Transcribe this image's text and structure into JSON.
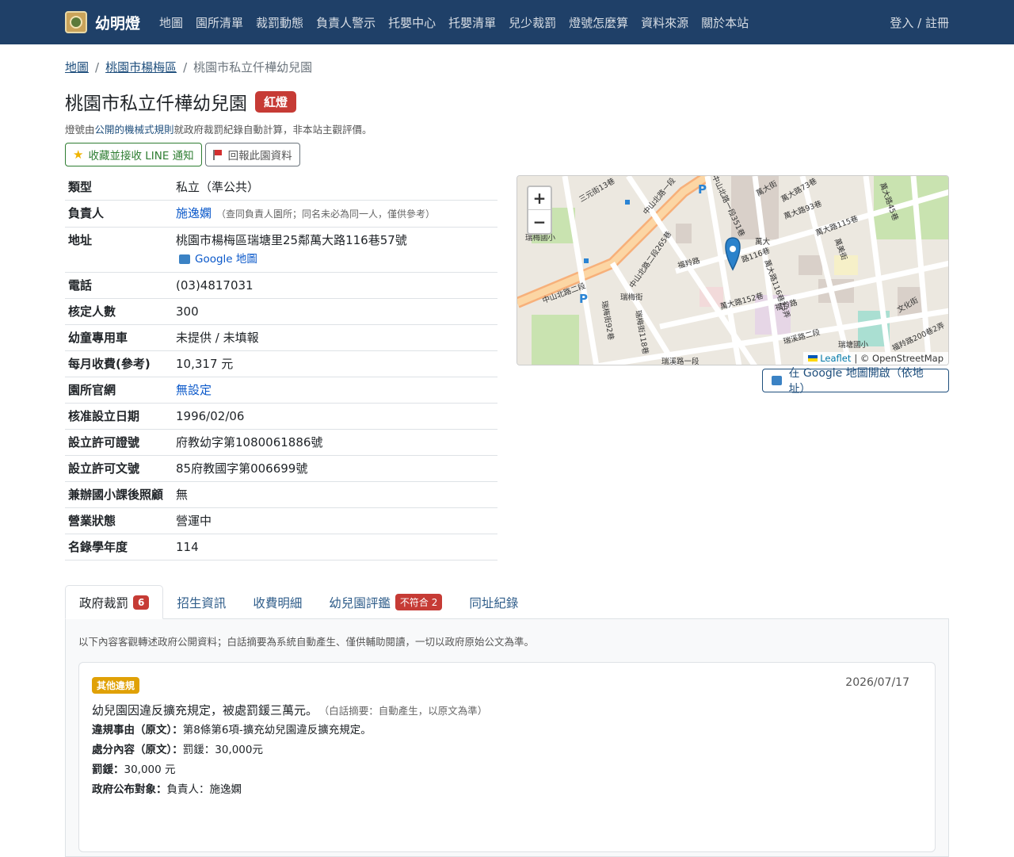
{
  "nav": {
    "brand": "幼明燈",
    "items": [
      "地圖",
      "園所清單",
      "裁罰動態",
      "負責人警示",
      "托嬰中心",
      "托嬰清單",
      "兒少裁罰",
      "燈號怎麼算",
      "資料來源",
      "關於本站"
    ],
    "auth": "登入 / 註冊"
  },
  "breadcrumb": {
    "home": "地圖",
    "district": "桃園市楊梅區",
    "current": "桃園市私立仟樺幼兒園"
  },
  "page": {
    "title": "桃園市私立仟樺幼兒園",
    "light_badge": "紅燈",
    "note_prefix": "燈號由",
    "note_link": "公開的機械式規則",
    "note_suffix": "就政府裁罰紀錄自動計算，非本站主觀評價。"
  },
  "actions": {
    "follow": "收藏並接收 LINE 通知",
    "report": "回報此園資料"
  },
  "info": {
    "type_label": "類型",
    "type": "私立（準公共）",
    "owner_label": "負責人",
    "owner": "施逸嫻",
    "owner_note": "（查同負責人園所；同名未必為同一人，僅供參考）",
    "address_label": "地址",
    "address": "桃園市楊梅區瑞塘里25鄰萬大路116巷57號",
    "gmap_link": "Google 地圖",
    "phone_label": "電話",
    "phone": "(03)4817031",
    "capacity_label": "核定人數",
    "capacity": "300",
    "bus_label": "幼童專用車",
    "bus": "未提供 / 未填報",
    "fee_label": "每月收費(參考)",
    "fee": "10,317 元",
    "website_label": "園所官網",
    "website": "無設定",
    "approved_label": "核准設立日期",
    "approved": "1996/02/06",
    "permit_label": "設立許可證號",
    "permit": "府教幼字第1080061886號",
    "doc_label": "設立許可文號",
    "doc": "85府教國字第006699號",
    "afterschool_label": "兼辦國小課後照顧",
    "afterschool": "無",
    "status_label": "營業狀態",
    "status": "營運中",
    "year_label": "名錄學年度",
    "year": "114"
  },
  "map": {
    "zoom_in": "+",
    "zoom_out": "−",
    "attribution_leaflet": "Leaflet",
    "attribution_osm": "| © OpenStreetMap",
    "open_google": "在 Google 地圖開啟（依地址）",
    "labels": {
      "l1": "三元街13巷",
      "l2": "中山北路二段",
      "l3": "萬大街",
      "l4": "中山北路一段351巷",
      "l5": "萬大路73巷",
      "l6": "瑞梅國小",
      "l7": "萬大路93巷",
      "l8": "萬大路115巷",
      "l9": "萬大路45巷",
      "l10": "福羚路",
      "l11": "萬大",
      "l12": "路116巷",
      "l13": "中山北路二段265巷",
      "l14": "萬大路116巷23弄",
      "l15": "瑞梅街",
      "l16": "萬大路152巷",
      "l17": "福羚路",
      "l18": "瑞溪路二段",
      "l19": "瑞塘國小",
      "l20": "福羚路200巷2弄",
      "l21": "瑞梅街92巷",
      "l22": "瑞梅街118巷",
      "l23": "瑞溪路一段",
      "l24": "文化街",
      "l25": "中山北路一段",
      "l26": "萬美街"
    }
  },
  "tabs": {
    "penalties": "政府裁罰",
    "penalties_count": "6",
    "enroll": "招生資訊",
    "fees": "收費明細",
    "eval": "幼兒園評鑑",
    "eval_badge": "不符合 2",
    "same_address": "同址紀錄"
  },
  "panel": {
    "note": "以下內容客觀轉述政府公開資料；白話摘要為系統自動產生、僅供輔助閱讀，一切以政府原始公文為準。",
    "card": {
      "tag": "其他違規",
      "date": "2026/07/17",
      "summary": "幼兒園因違反擴充規定，被處罰鍰三萬元。",
      "summary_note": "（白話摘要：自動產生，以原文為準）",
      "reason_label": "違規事由（原文）：",
      "reason": "第8條第6項-擴充幼兒園違反擴充規定。",
      "content_label": "處分內容（原文）：",
      "content": "罰鍰：30,000元",
      "fine_label": "罰鍰：",
      "fine": "30,000 元",
      "target_label": "政府公布對象：",
      "target": "負責人：施逸嫻"
    }
  },
  "colors": {
    "navbar": "#1f4068",
    "red_light": "#c63b35",
    "tag_other": "#e0a106",
    "link": "#1f4f7d"
  }
}
